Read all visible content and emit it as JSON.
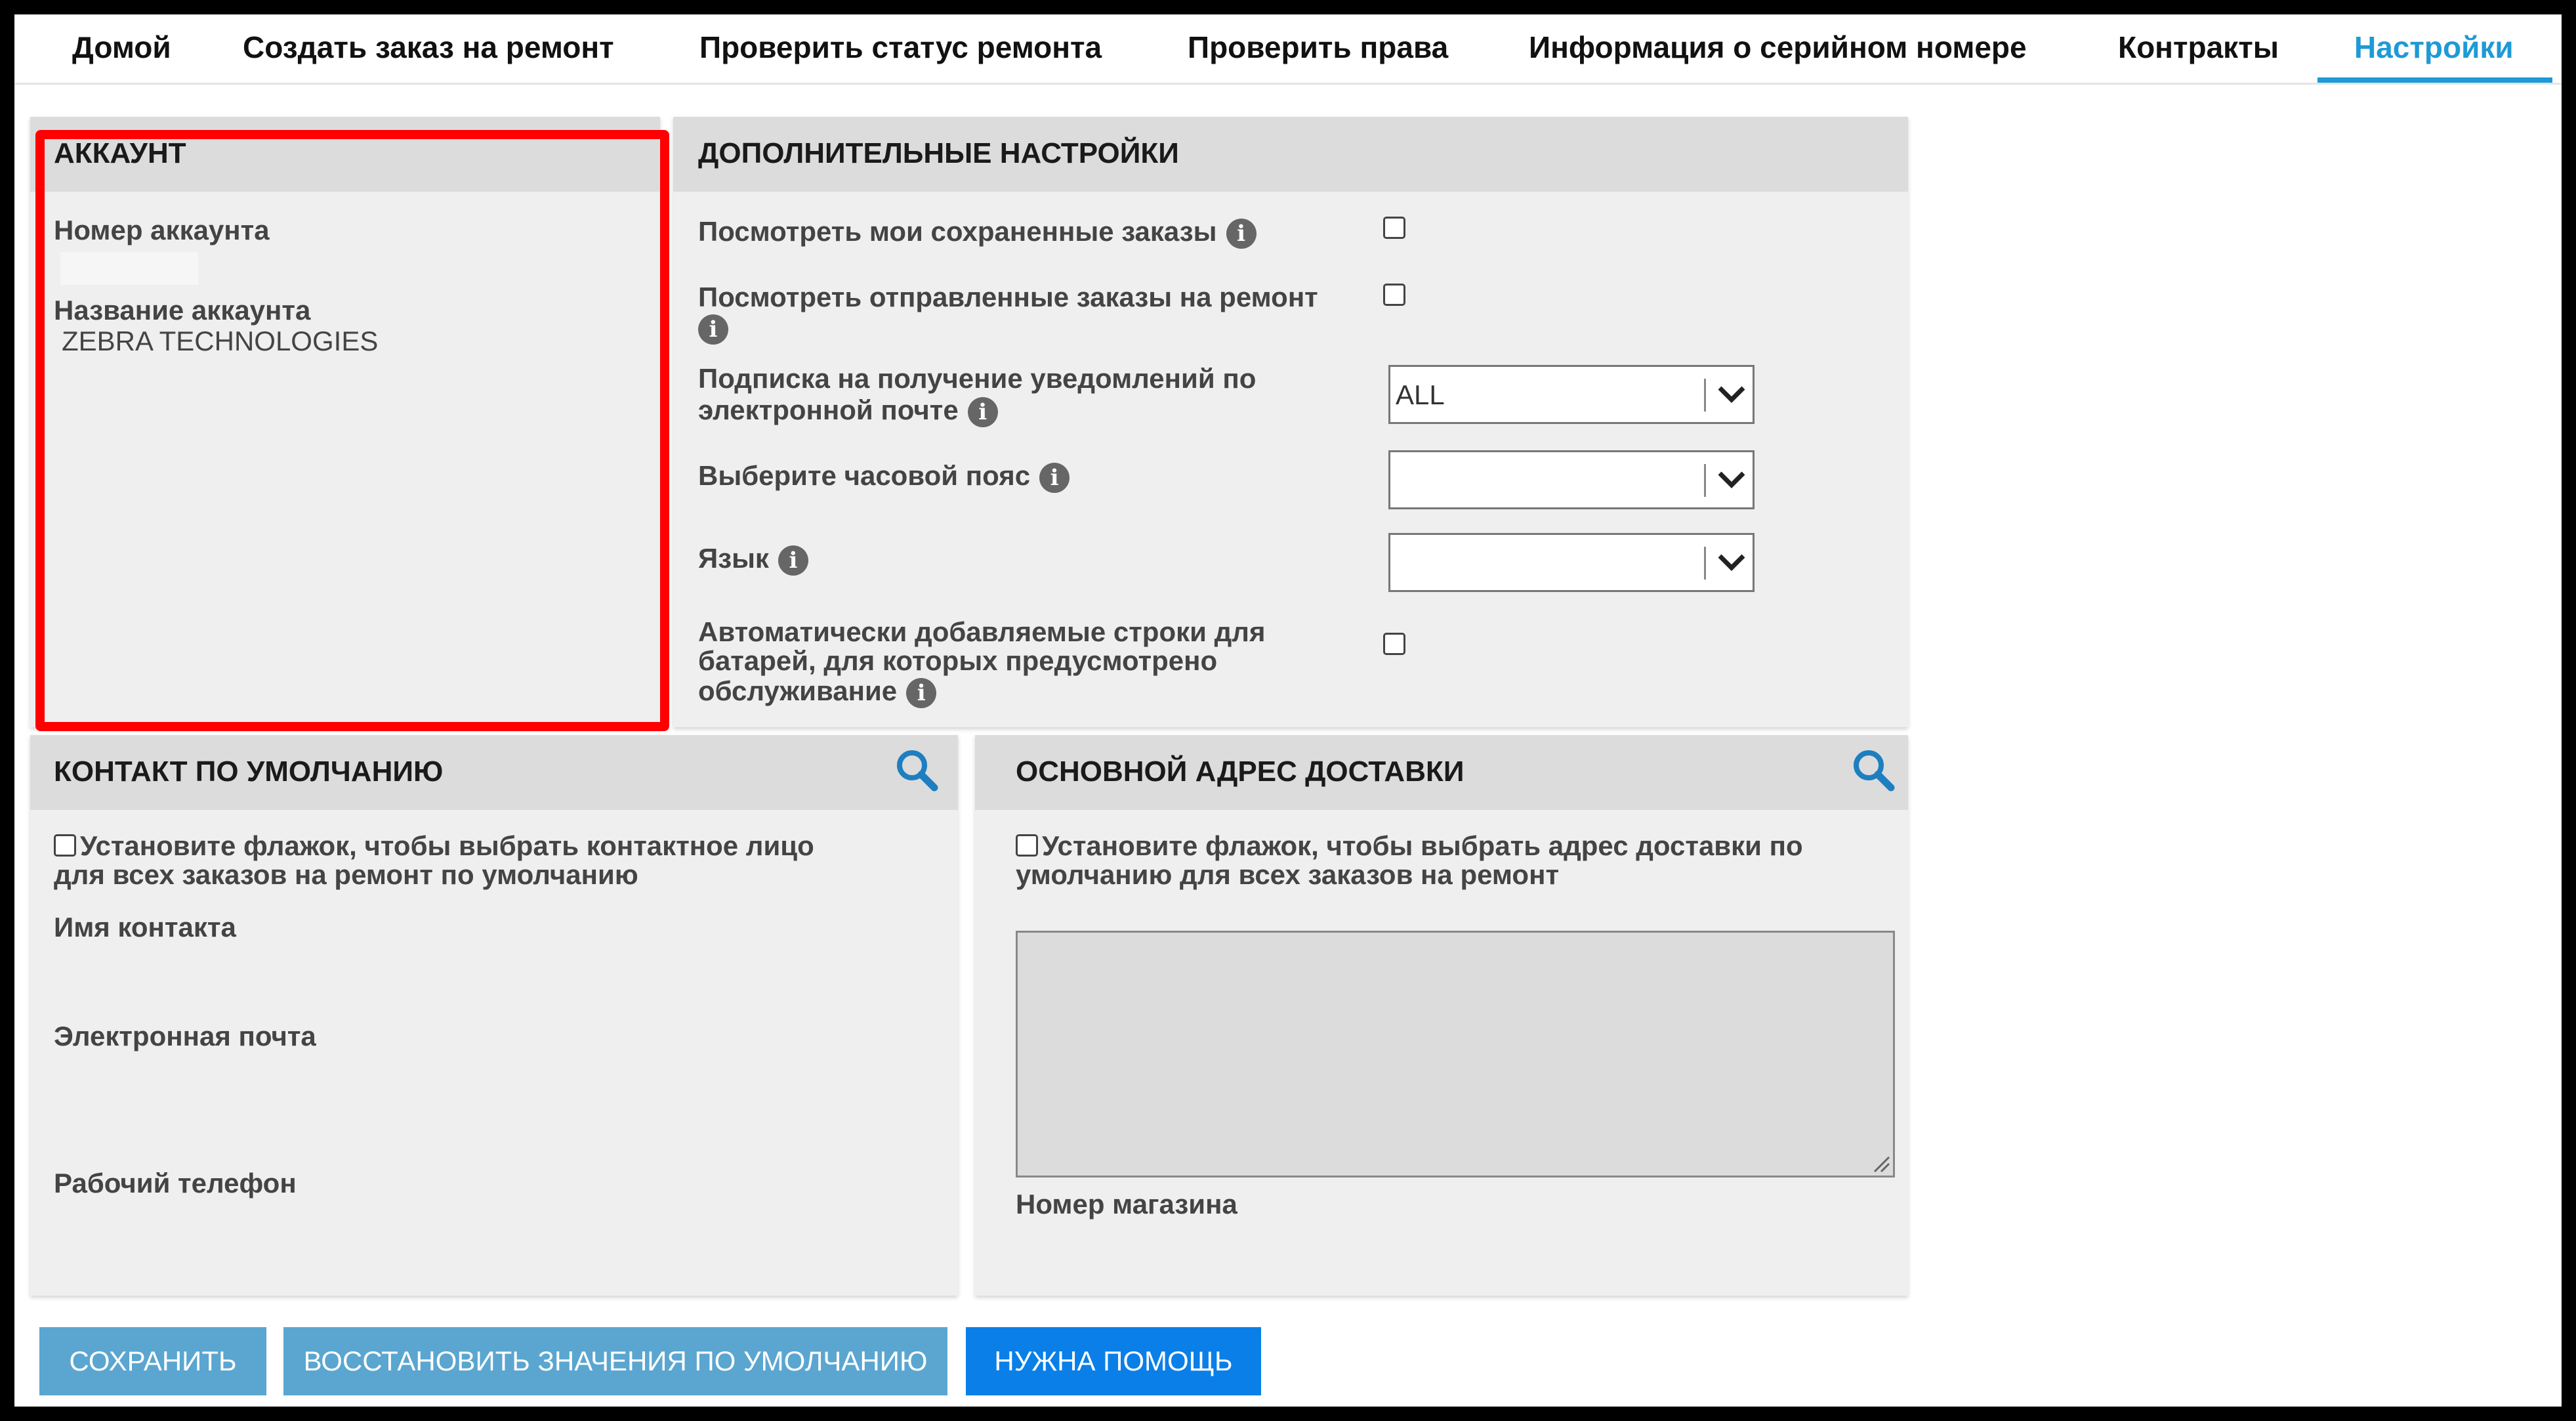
{
  "nav": {
    "items": [
      {
        "label": "Домой"
      },
      {
        "label": "Создать заказ на ремонт"
      },
      {
        "label": "Проверить статус ремонта"
      },
      {
        "label": "Проверить права"
      },
      {
        "label": "Информация о серийном номере"
      },
      {
        "label": "Контракты"
      },
      {
        "label": "Настройки",
        "active": true
      }
    ]
  },
  "account": {
    "title": "АККАУНТ",
    "number_label": "Номер аккаунта",
    "number_value": "",
    "name_label": "Название аккаунта",
    "name_value": "ZEBRA TECHNOLOGIES"
  },
  "additional": {
    "title": "ДОПОЛНИТЕЛЬНЫЕ НАСТРОЙКИ",
    "saved_orders_label": "Посмотреть мои сохраненные заказы",
    "sent_orders_label": "Посмотреть отправленные заказы на ремонт",
    "email_sub_line1": "Подписка на получение уведомлений по",
    "email_sub_line2": "электронной почте",
    "email_sub_value": "ALL",
    "timezone_label": "Выберите часовой пояс",
    "timezone_value": "",
    "language_label": "Язык",
    "language_value": "",
    "battery_line1": "Автоматически добавляемые строки для",
    "battery_line2": "батарей, для которых предусмотрено",
    "battery_line3": "обслуживание",
    "info_glyph": "i"
  },
  "contact": {
    "title": "КОНТАКТ ПО УМОЛЧАНИЮ",
    "checkbox_line1": "Установите флажок, чтобы выбрать контактное лицо",
    "checkbox_line2": "для всех заказов на ремонт по умолчанию",
    "name_label": "Имя контакта",
    "email_label": "Электронная почта",
    "phone_label": "Рабочий телефон"
  },
  "shipping": {
    "title": "ОСНОВНОЙ АДРЕС ДОСТАВКИ",
    "checkbox_line1": "Установите флажок, чтобы  выбрать адрес доставки по",
    "checkbox_line2": "умолчанию для всех заказов на ремонт",
    "store_label": "Номер магазина"
  },
  "buttons": {
    "save": "СОХРАНИТЬ",
    "restore": "ВОССТАНОВИТЬ ЗНАЧЕНИЯ ПО УМОЛЧАНИЮ",
    "help": "НУЖНА ПОМОЩЬ"
  },
  "colors": {
    "accent": "#1e9ad6",
    "button_secondary": "#5aa6d0",
    "button_primary": "#0a7fe8",
    "highlight_box": "#ff0000"
  }
}
